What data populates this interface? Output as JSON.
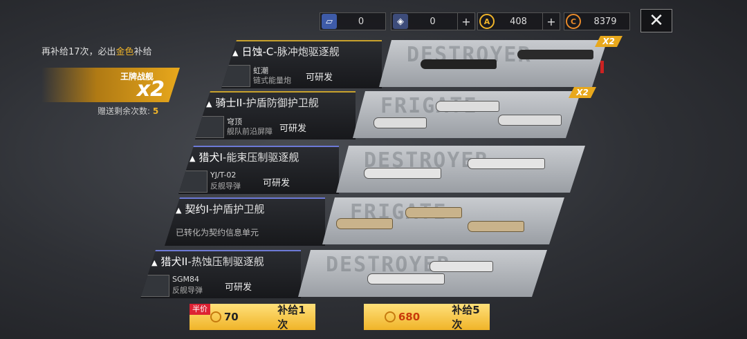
{
  "resources": [
    {
      "icon": "blueprint-icon",
      "value": "0",
      "plus": false
    },
    {
      "icon": "cube-icon",
      "value": "0",
      "plus": true,
      "plus_label": "+"
    },
    {
      "icon": "alloy-icon",
      "value": "408",
      "plus": true,
      "plus_label": "+"
    },
    {
      "icon": "credit-icon",
      "value": "8379",
      "plus": false
    }
  ],
  "close_label": "✕",
  "left": {
    "guarantee_pre": "再补给17次，必出",
    "guarantee_gold": "金色",
    "guarantee_post": "补给",
    "ace_title": "王牌战舰",
    "ace_mult": "x2",
    "gift_label": "赠送剩余次数:",
    "gift_count": "5"
  },
  "cards": [
    {
      "name": "日蚀-C",
      "sub": "-脉冲炮驱逐舰",
      "module": "虹潮",
      "module_type": "链式能量炮",
      "status": "可研发",
      "watermark": "DESTROYER",
      "x2": "X2",
      "tier": "gold"
    },
    {
      "name": "骑士II",
      "sub": "-护盾防御护卫舰",
      "module": "穹顶",
      "module_type": "舰队前沿屏障",
      "status": "可研发",
      "watermark": "FRIGATE",
      "x2": "X2",
      "tier": "gold"
    },
    {
      "name": "猎犬I",
      "sub": "-能束压制驱逐舰",
      "module": "YJ/T-02",
      "module_type": "反舰导弹",
      "status": "可研发",
      "watermark": "DESTROYER",
      "x2": "",
      "tier": "blue"
    },
    {
      "name": "契约I",
      "sub": "-护盾护卫舰",
      "module": "",
      "module_type": "",
      "status": "已转化为契约信息单元",
      "watermark": "FRIGATE",
      "x2": "",
      "tier": "blue"
    },
    {
      "name": "猎犬II",
      "sub": "-热蚀压制驱逐舰",
      "module": "SGM84",
      "module_type": "反舰导弹",
      "status": "可研发",
      "watermark": "DESTROYER",
      "x2": "",
      "tier": "blue"
    }
  ],
  "buttons": {
    "half_label": "半价",
    "one_cost": "70",
    "one_label": "补给1次",
    "five_cost": "680",
    "five_label": "补给5次"
  },
  "colors": {
    "gold": "#f0b429",
    "accent_blue": "#6d7ad8"
  }
}
